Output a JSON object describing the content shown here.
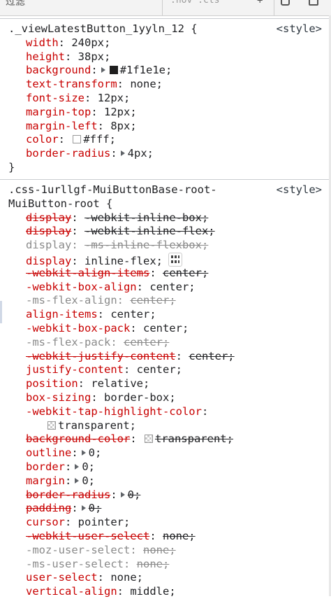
{
  "topbar": {
    "filter_label": "过滤",
    "toggles": ":hov .cls",
    "arrow": "+"
  },
  "rules": [
    {
      "selector": "._viewLatestButton_1yyln_12 {",
      "source": "<style>",
      "declarations": [
        {
          "prop": "width",
          "val": "240px;"
        },
        {
          "prop": "height",
          "val": "38px;"
        },
        {
          "prop": "background",
          "val": "#1f1e1e;"
        },
        {
          "prop": "text-transform",
          "val": "none;"
        },
        {
          "prop": "font-size",
          "val": "12px;"
        },
        {
          "prop": "margin-top",
          "val": "12px;"
        },
        {
          "prop": "margin-left",
          "val": "8px;"
        },
        {
          "prop": "color",
          "val": "#fff;"
        },
        {
          "prop": "border-radius",
          "val": "4px;"
        }
      ],
      "close": "}"
    },
    {
      "selector_line1": ".css-1urllgf-MuiButtonBase-root-",
      "selector_line2": "MuiButton-root {",
      "source": "<style>",
      "declarations": [
        {
          "prop": "display",
          "val": "-webkit-inline-box;"
        },
        {
          "prop": "display",
          "val": "-webkit-inline-flex;"
        },
        {
          "prop": "display",
          "val": "-ms-inline-flexbox;"
        },
        {
          "prop": "display",
          "val": "inline-flex;"
        },
        {
          "prop": "-webkit-align-items",
          "val": "center;"
        },
        {
          "prop": "-webkit-box-align",
          "val": "center;"
        },
        {
          "prop": "-ms-flex-align",
          "val": "center;"
        },
        {
          "prop": "align-items",
          "val": "center;"
        },
        {
          "prop": "-webkit-box-pack",
          "val": "center;"
        },
        {
          "prop": "-ms-flex-pack",
          "val": "center;"
        },
        {
          "prop": "-webkit-justify-content",
          "val": "center;"
        },
        {
          "prop": "justify-content",
          "val": "center;"
        },
        {
          "prop": "position",
          "val": "relative;"
        },
        {
          "prop": "box-sizing",
          "val": "border-box;"
        },
        {
          "prop": "-webkit-tap-highlight-color",
          "val": ""
        },
        {
          "prop": "",
          "val": "transparent;"
        },
        {
          "prop": "background-color",
          "val": "transparent;"
        },
        {
          "prop": "outline",
          "val": "0;"
        },
        {
          "prop": "border",
          "val": "0;"
        },
        {
          "prop": "margin",
          "val": "0;"
        },
        {
          "prop": "border-radius",
          "val": "0;"
        },
        {
          "prop": "padding",
          "val": "0;"
        },
        {
          "prop": "cursor",
          "val": "pointer;"
        },
        {
          "prop": "-webkit-user-select",
          "val": "none;"
        },
        {
          "prop": "-moz-user-select",
          "val": "none;"
        },
        {
          "prop": "-ms-user-select",
          "val": "none;"
        },
        {
          "prop": "user-select",
          "val": "none;"
        },
        {
          "prop": "vertical-align",
          "val": "middle;"
        }
      ]
    }
  ],
  "colors": {
    "background_swatch": "#1f1e1e",
    "color_swatch": "#ffffff",
    "property_red": "#c80000"
  }
}
